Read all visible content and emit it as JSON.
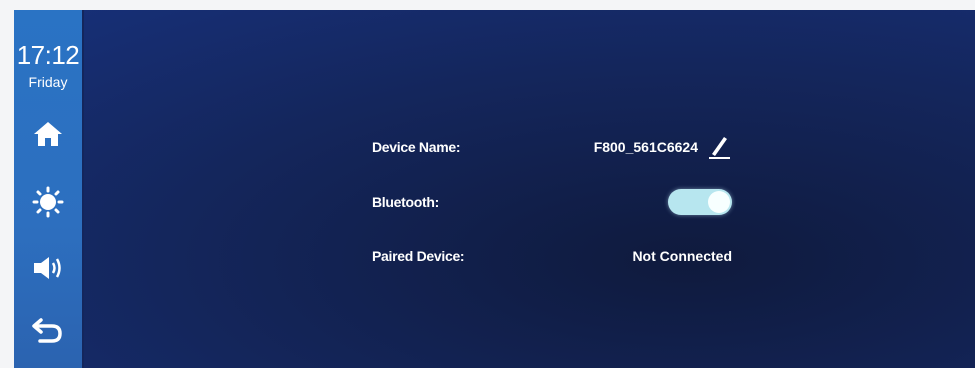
{
  "sidebar": {
    "time": "17:12",
    "day": "Friday",
    "buttons": [
      {
        "icon": "home-icon"
      },
      {
        "icon": "brightness-icon"
      },
      {
        "icon": "volume-icon"
      },
      {
        "icon": "back-icon"
      }
    ]
  },
  "settings": {
    "device_name_label": "Device Name:",
    "device_name_value": "F800_561C6624",
    "bluetooth_label": "Bluetooth:",
    "bluetooth_on": true,
    "paired_device_label": "Paired Device:",
    "paired_device_value": "Not Connected"
  },
  "colors": {
    "sidebar": "#2a73c4",
    "background": "#14265c",
    "toggle_on": "#b7e6ef"
  }
}
